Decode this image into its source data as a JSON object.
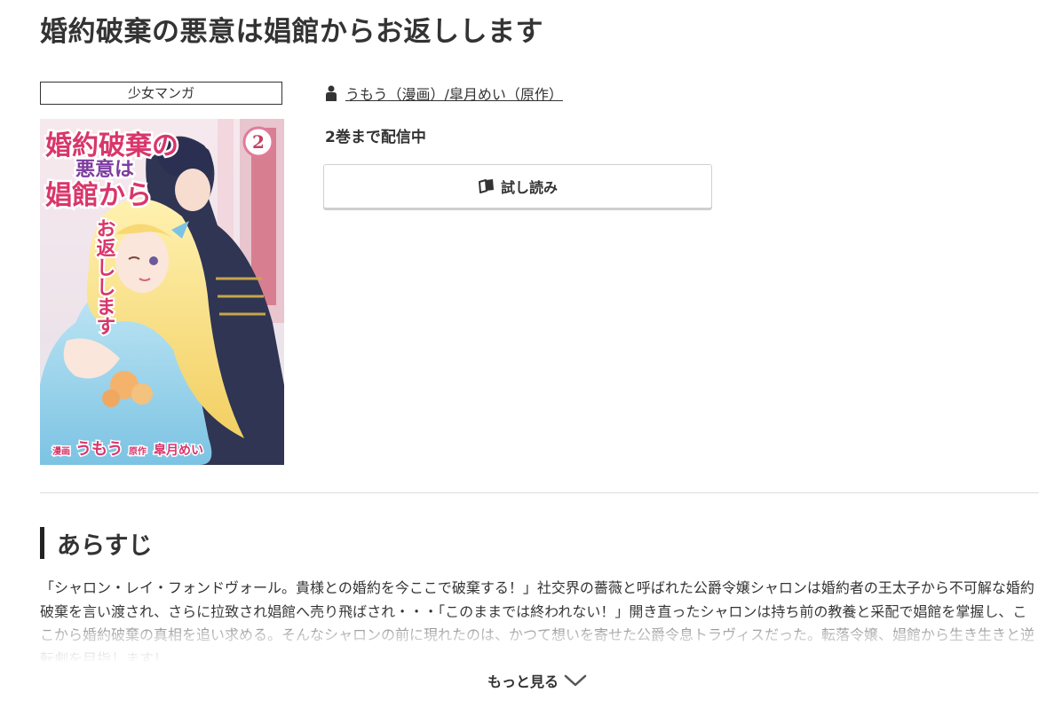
{
  "title": "婚約破棄の悪意は娼館からお返しします",
  "genre": "少女マンガ",
  "author": {
    "icon": "person-icon",
    "text": "うもう（漫画）/皐月めい（原作）"
  },
  "volume_status": "2巻まで配信中",
  "trial_button": {
    "icon": "open-book-icon",
    "label": "試し読み"
  },
  "cover": {
    "title_lines": [
      "婚約破棄の",
      "悪意は",
      "娼館から",
      "お返しします"
    ],
    "volume": "2",
    "credit_manga_label": "漫画",
    "credit_manga": "うもう",
    "credit_original_label": "原作",
    "credit_original": "皐月めい"
  },
  "synopsis": {
    "heading": "あらすじ",
    "text": "「シャロン・レイ・フォンドヴォール。貴様との婚約を今ここで破棄する！」社交界の薔薇と呼ばれた公爵令嬢シャロンは婚約者の王太子から不可解な婚約破棄を言い渡され、さらに拉致され娼館へ売り飛ばされ・・・「このままでは終われない！」開き直ったシャロンは持ち前の教養と采配で娼館を掌握し、ここから婚約破棄の真相を追い求める。そんなシャロンの前に現れたのは、かつて想いを寄せた公爵令息トラヴィスだった。転落令嬢、娼館から生き生きと逆転劇を目指します！"
  },
  "more_button": {
    "label": "もっと見る",
    "icon": "chevron-down-icon"
  },
  "colors": {
    "text": "#333333",
    "divider": "#dddddd",
    "heading_bar": "#222222"
  }
}
